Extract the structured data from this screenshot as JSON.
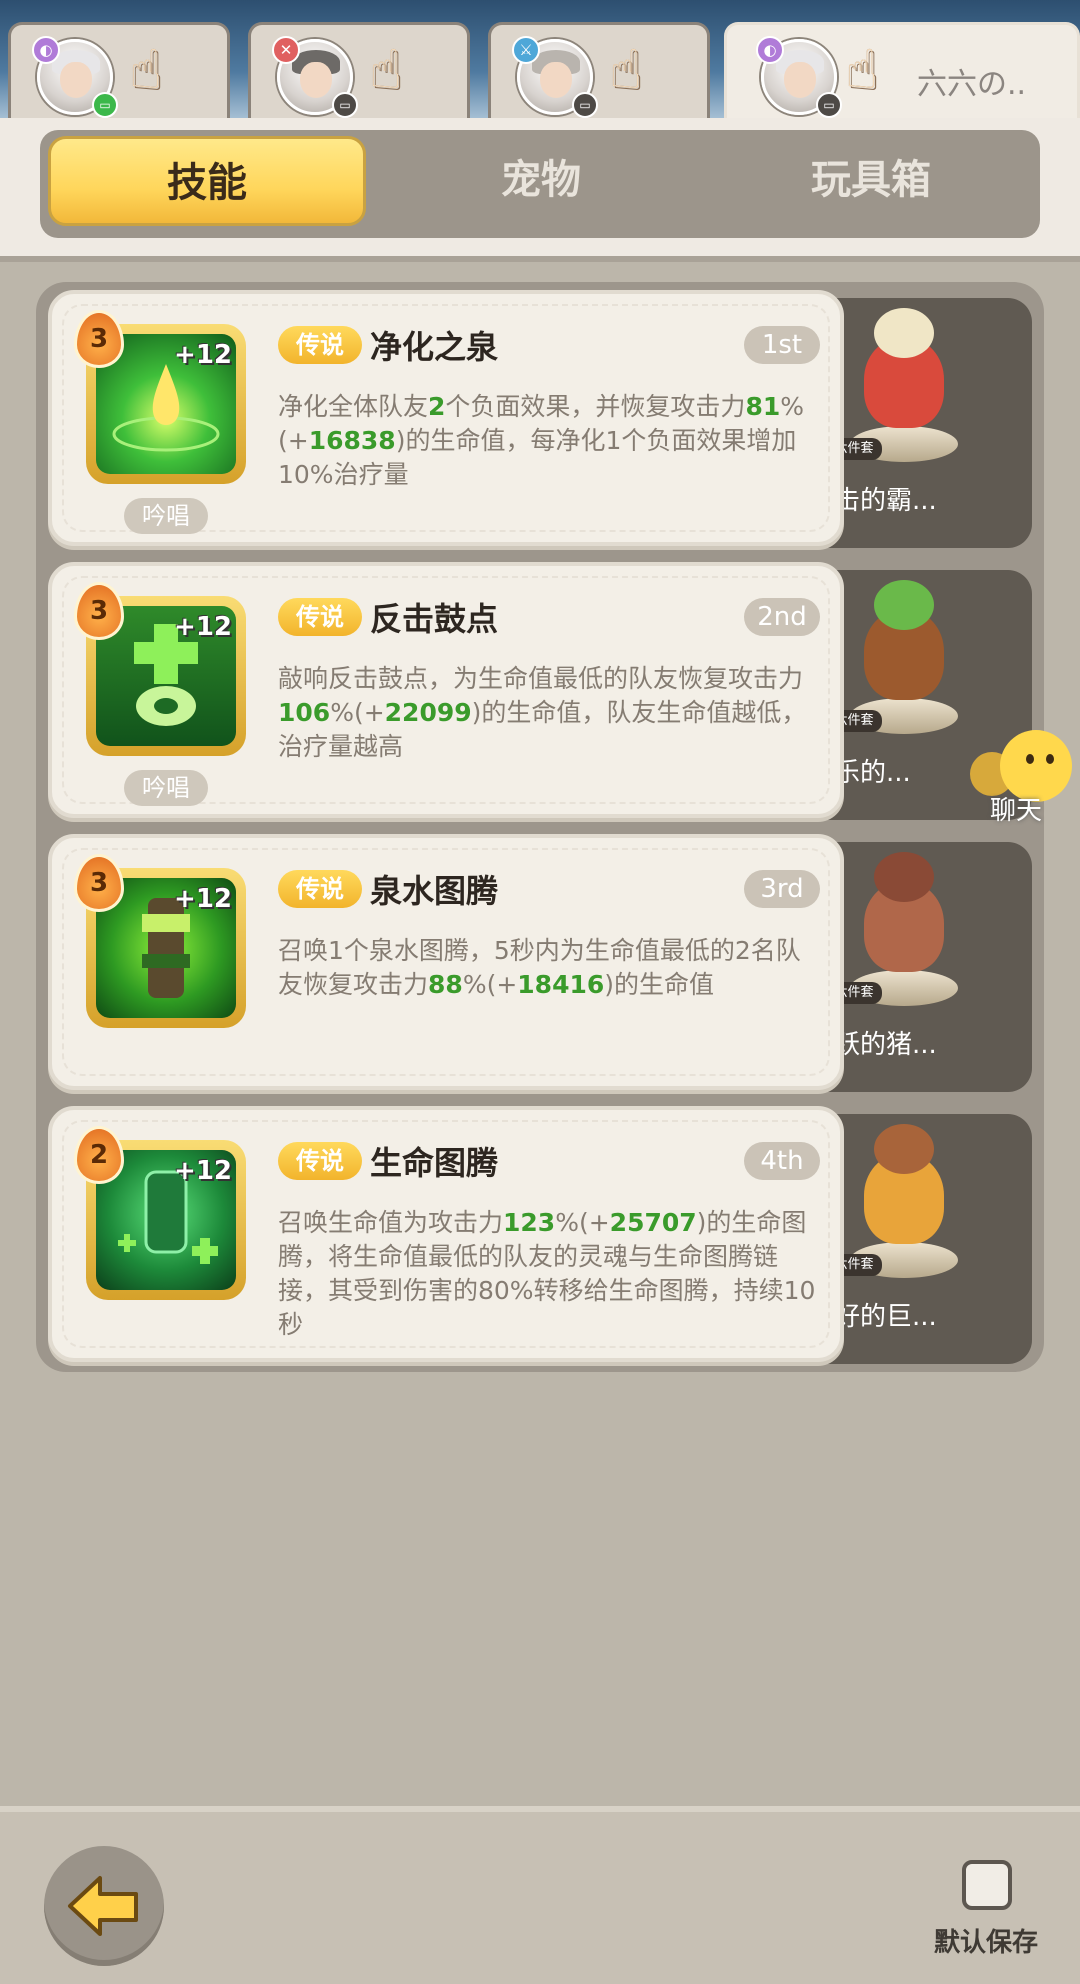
{
  "hero_tabs": [
    {
      "name": "",
      "status": "online",
      "class_color": "#b07bd8"
    },
    {
      "name": "",
      "status": "offline",
      "class_color": "#e06060"
    },
    {
      "name": "",
      "status": "offline",
      "class_color": "#4ea7d8"
    },
    {
      "name": "六六の..",
      "status": "offline",
      "class_color": "#b07bd8",
      "active": true
    }
  ],
  "tabs": [
    {
      "label": "技能",
      "active": true
    },
    {
      "label": "宠物",
      "active": false
    },
    {
      "label": "玩具箱",
      "active": false
    }
  ],
  "skills": [
    {
      "level": "3",
      "plus": "+12",
      "chant": "吟唱",
      "rarity": "传说",
      "name": "净化之泉",
      "rank": "1st",
      "desc": [
        "净化全体队友",
        "2",
        "个负面效果，并恢复攻击力",
        "81",
        "%(+",
        "16838",
        ")的生命值，每净化1个负面效果增加10%治疗量"
      ],
      "pet_set": "六件套",
      "pet_name": "进击的霸..."
    },
    {
      "level": "3",
      "plus": "+12",
      "chant": "吟唱",
      "rarity": "传说",
      "name": "反击鼓点",
      "rank": "2nd",
      "desc": [
        "敲响反击鼓点，为生命值最低的队友恢复攻击力",
        "106",
        "%(+",
        "22099",
        ")的生命值，队友生命值越低，治疗量越高"
      ],
      "pet_set": "六件套",
      "pet_name": "快乐的..."
    },
    {
      "level": "3",
      "plus": "+12",
      "chant": "",
      "rarity": "传说",
      "name": "泉水图腾",
      "rank": "3rd",
      "desc": [
        "召唤1个泉水图腾，5秒内为生命值最低的2名队友恢复攻击力",
        "88",
        "%(+",
        "18416",
        ")的生命值"
      ],
      "pet_set": "六件套",
      "pet_name": "活跃的猪..."
    },
    {
      "level": "2",
      "plus": "+12",
      "chant": "",
      "rarity": "传说",
      "name": "生命图腾",
      "rank": "4th",
      "desc": [
        "召唤生命值为攻击力",
        "123",
        "%(+",
        "25707",
        ")的生命图腾，将生命值最低的队友的灵魂与生命图腾链接，其受到伤害的80%转移给生命图腾，持续10秒"
      ],
      "pet_set": "六件套",
      "pet_name": "友好的巨..."
    }
  ],
  "chat": {
    "label": "聊天"
  },
  "bottom": {
    "save_label": "默认保存"
  },
  "colors": {
    "accent_yellow": "#ffd65b",
    "value_green": "#3a9b2b",
    "panel": "#9d968c"
  }
}
